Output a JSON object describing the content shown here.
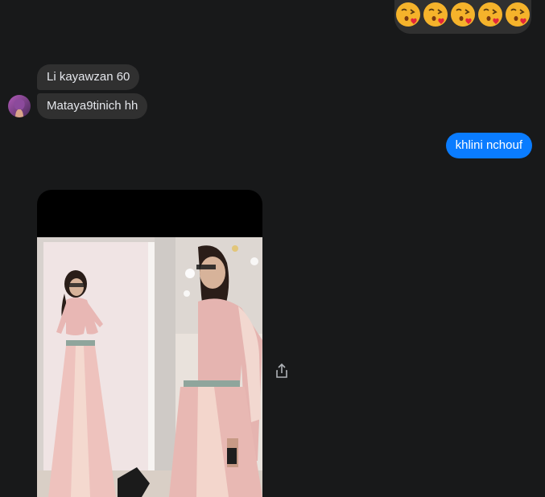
{
  "conversation": {
    "outgoing_reaction": {
      "emojis": [
        "face-blowing-kiss-emoji",
        "face-blowing-kiss-emoji",
        "face-blowing-kiss-emoji",
        "face-blowing-kiss-emoji",
        "face-blowing-kiss-emoji"
      ]
    },
    "incoming_messages": [
      {
        "text": "Li kayawzan 60"
      },
      {
        "text": "Mataya9tinich hh"
      }
    ],
    "outgoing_message": {
      "text": "khlini nchouf"
    },
    "attachment": {
      "kind": "photo",
      "share_icon": "share-icon"
    }
  },
  "colors": {
    "background": "#18191a",
    "incoming_bubble": "#303030",
    "outgoing_bubble": "#0a7cff",
    "text_light": "#e4e6eb"
  }
}
